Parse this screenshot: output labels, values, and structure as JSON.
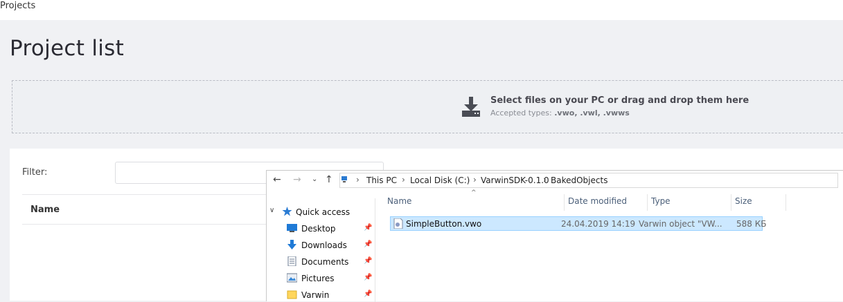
{
  "breadcrumb": "Projects",
  "page_title": "Project list",
  "dropzone": {
    "title": "Select files on your PC or drag and drop them here",
    "accepted_prefix": "Accepted types: ",
    "accepted_types": ".vwo, .vwl, .vwws"
  },
  "filter": {
    "label": "Filter:",
    "value": ""
  },
  "table": {
    "name_header": "Name"
  },
  "dialog": {
    "path": [
      "This PC",
      "Local Disk (C:)",
      "VarwinSDK-0.1.0",
      "BakedObjects"
    ],
    "quick_access_label": "Quick access",
    "tree_items": [
      {
        "label": "Desktop",
        "icon": "desktop-icon"
      },
      {
        "label": "Downloads",
        "icon": "downloads-icon"
      },
      {
        "label": "Documents",
        "icon": "documents-icon"
      },
      {
        "label": "Pictures",
        "icon": "pictures-icon"
      },
      {
        "label": "Varwin",
        "icon": "folder-icon"
      }
    ],
    "columns": {
      "name": "Name",
      "date_modified": "Date modified",
      "type": "Type",
      "size": "Size"
    },
    "files": [
      {
        "name": "SimpleButton.vwo",
        "date_modified": "24.04.2019 14:19",
        "type": "Varwin object \"VW...",
        "size": "588 КБ"
      }
    ]
  },
  "colors": {
    "accent_selection": "#cce8ff",
    "page_bg": "#f0f1f4"
  }
}
